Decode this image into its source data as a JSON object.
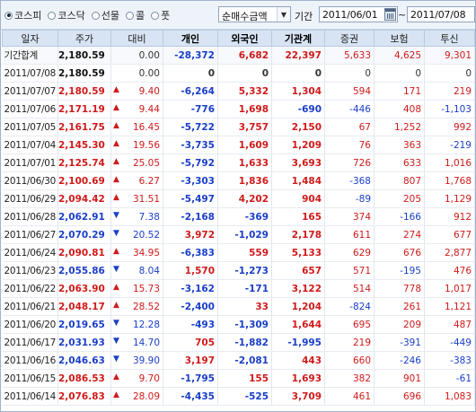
{
  "toolbar": {
    "markets": [
      {
        "label": "코스피",
        "selected": true
      },
      {
        "label": "코스닥",
        "selected": false
      },
      {
        "label": "선물",
        "selected": false
      },
      {
        "label": "콜",
        "selected": false
      },
      {
        "label": "풋",
        "selected": false
      }
    ],
    "select_value": "순매수금액",
    "period_label": "기간",
    "start_date": "2011/06/01",
    "tilde": "~",
    "end_date": "2011/07/08"
  },
  "columns": [
    "일자",
    "주가",
    "대비",
    "개인",
    "외국인",
    "기관계",
    "증권",
    "보험",
    "투신"
  ],
  "colors": {
    "up": "#d01a1a",
    "down": "#1a3ec8",
    "header_bg": "#d8e4f3"
  },
  "rows": [
    {
      "date": "기간합계",
      "price": "2,180.59",
      "dir": "",
      "change": "0.00",
      "indiv": "-28,372",
      "foreign": "6,682",
      "inst": "22,397",
      "sec": "5,633",
      "ins": "4,625",
      "trust": "9,301"
    },
    {
      "date": "2011/07/08",
      "price": "2,180.59",
      "dir": "",
      "change": "0.00",
      "indiv": "0",
      "foreign": "0",
      "inst": "0",
      "sec": "0",
      "ins": "0",
      "trust": "0"
    },
    {
      "date": "2011/07/07",
      "price": "2,180.59",
      "dir": "up",
      "change": "9.40",
      "indiv": "-6,264",
      "foreign": "5,332",
      "inst": "1,304",
      "sec": "594",
      "ins": "171",
      "trust": "219"
    },
    {
      "date": "2011/07/06",
      "price": "2,171.19",
      "dir": "up",
      "change": "9.44",
      "indiv": "-776",
      "foreign": "1,698",
      "inst": "-690",
      "sec": "-446",
      "ins": "408",
      "trust": "-1,103"
    },
    {
      "date": "2011/07/05",
      "price": "2,161.75",
      "dir": "up",
      "change": "16.45",
      "indiv": "-5,722",
      "foreign": "3,757",
      "inst": "2,150",
      "sec": "67",
      "ins": "1,252",
      "trust": "992"
    },
    {
      "date": "2011/07/04",
      "price": "2,145.30",
      "dir": "up",
      "change": "19.56",
      "indiv": "-3,735",
      "foreign": "1,609",
      "inst": "1,209",
      "sec": "76",
      "ins": "363",
      "trust": "-219"
    },
    {
      "date": "2011/07/01",
      "price": "2,125.74",
      "dir": "up",
      "change": "25.05",
      "indiv": "-5,792",
      "foreign": "1,633",
      "inst": "3,693",
      "sec": "726",
      "ins": "633",
      "trust": "1,016"
    },
    {
      "date": "2011/06/30",
      "price": "2,100.69",
      "dir": "up",
      "change": "6.27",
      "indiv": "-3,303",
      "foreign": "1,836",
      "inst": "1,484",
      "sec": "-368",
      "ins": "807",
      "trust": "1,768"
    },
    {
      "date": "2011/06/29",
      "price": "2,094.42",
      "dir": "up",
      "change": "31.51",
      "indiv": "-5,497",
      "foreign": "4,202",
      "inst": "904",
      "sec": "-89",
      "ins": "205",
      "trust": "1,129"
    },
    {
      "date": "2011/06/28",
      "price": "2,062.91",
      "dir": "down",
      "change": "7.38",
      "indiv": "-2,168",
      "foreign": "-369",
      "inst": "165",
      "sec": "374",
      "ins": "-166",
      "trust": "912"
    },
    {
      "date": "2011/06/27",
      "price": "2,070.29",
      "dir": "down",
      "change": "20.52",
      "indiv": "3,972",
      "foreign": "-1,029",
      "inst": "2,178",
      "sec": "611",
      "ins": "274",
      "trust": "677"
    },
    {
      "date": "2011/06/24",
      "price": "2,090.81",
      "dir": "up",
      "change": "34.95",
      "indiv": "-6,383",
      "foreign": "559",
      "inst": "5,133",
      "sec": "629",
      "ins": "676",
      "trust": "2,877"
    },
    {
      "date": "2011/06/23",
      "price": "2,055.86",
      "dir": "down",
      "change": "8.04",
      "indiv": "1,570",
      "foreign": "-1,273",
      "inst": "657",
      "sec": "571",
      "ins": "-195",
      "trust": "476"
    },
    {
      "date": "2011/06/22",
      "price": "2,063.90",
      "dir": "up",
      "change": "15.73",
      "indiv": "-3,162",
      "foreign": "-171",
      "inst": "3,122",
      "sec": "514",
      "ins": "778",
      "trust": "1,017"
    },
    {
      "date": "2011/06/21",
      "price": "2,048.17",
      "dir": "up",
      "change": "28.52",
      "indiv": "-2,400",
      "foreign": "33",
      "inst": "1,204",
      "sec": "-824",
      "ins": "261",
      "trust": "1,121"
    },
    {
      "date": "2011/06/20",
      "price": "2,019.65",
      "dir": "down",
      "change": "12.28",
      "indiv": "-493",
      "foreign": "-1,309",
      "inst": "1,644",
      "sec": "695",
      "ins": "209",
      "trust": "487"
    },
    {
      "date": "2011/06/17",
      "price": "2,031.93",
      "dir": "down",
      "change": "14.70",
      "indiv": "705",
      "foreign": "-1,882",
      "inst": "-1,995",
      "sec": "219",
      "ins": "-391",
      "trust": "-449"
    },
    {
      "date": "2011/06/16",
      "price": "2,046.63",
      "dir": "down",
      "change": "39.90",
      "indiv": "3,197",
      "foreign": "-2,081",
      "inst": "443",
      "sec": "660",
      "ins": "-246",
      "trust": "-383"
    },
    {
      "date": "2011/06/15",
      "price": "2,086.53",
      "dir": "up",
      "change": "9.70",
      "indiv": "-1,795",
      "foreign": "155",
      "inst": "1,693",
      "sec": "382",
      "ins": "901",
      "trust": "-61"
    },
    {
      "date": "2011/06/14",
      "price": "2,076.83",
      "dir": "up",
      "change": "28.09",
      "indiv": "-4,435",
      "foreign": "-525",
      "inst": "3,709",
      "sec": "461",
      "ins": "696",
      "trust": "1,083"
    }
  ]
}
